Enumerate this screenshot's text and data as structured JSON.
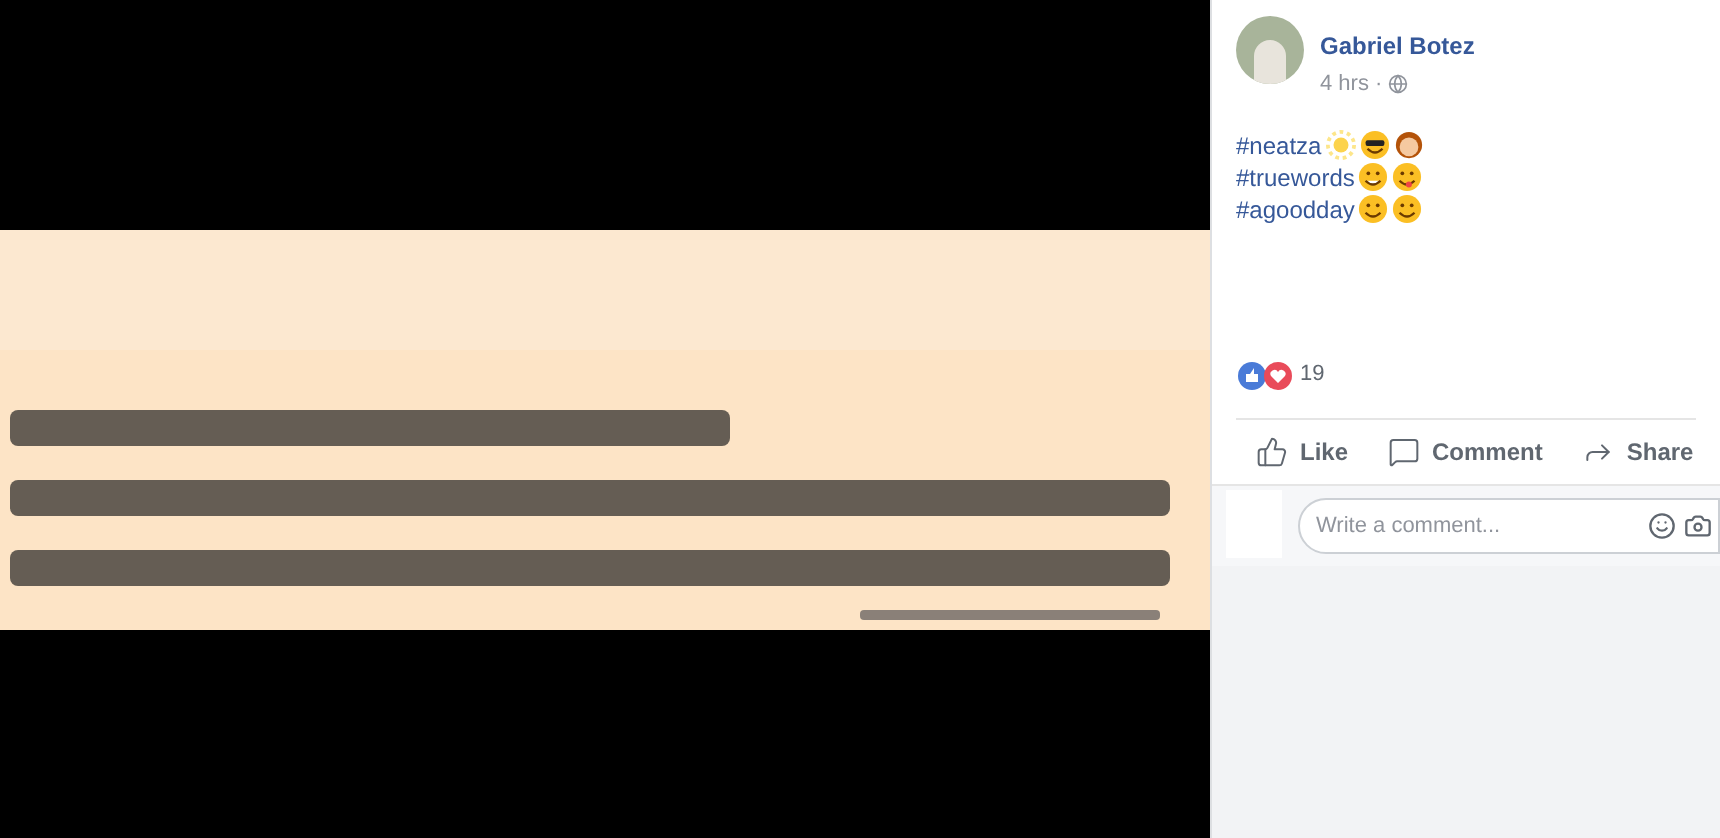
{
  "post": {
    "author": "Gabriel Botez",
    "time": "4 hrs",
    "separator": "·",
    "hashtags": [
      {
        "tag": "#neatza",
        "emojis": [
          {
            "kind": "sun"
          },
          {
            "kind": "sunglasses"
          },
          {
            "kind": "person"
          }
        ]
      },
      {
        "tag": "#truewords",
        "emojis": [
          {
            "kind": "grin"
          },
          {
            "kind": "tongue"
          }
        ]
      },
      {
        "tag": "#agoodday",
        "emojis": [
          {
            "kind": "smile"
          },
          {
            "kind": "smile"
          }
        ]
      }
    ],
    "reaction_count": "19",
    "actions": [
      {
        "kind": "like",
        "label": "Like"
      },
      {
        "kind": "comment",
        "label": "Comment"
      },
      {
        "kind": "share",
        "label": "Share"
      }
    ],
    "comment": {
      "placeholder": "Write a comment..."
    }
  }
}
